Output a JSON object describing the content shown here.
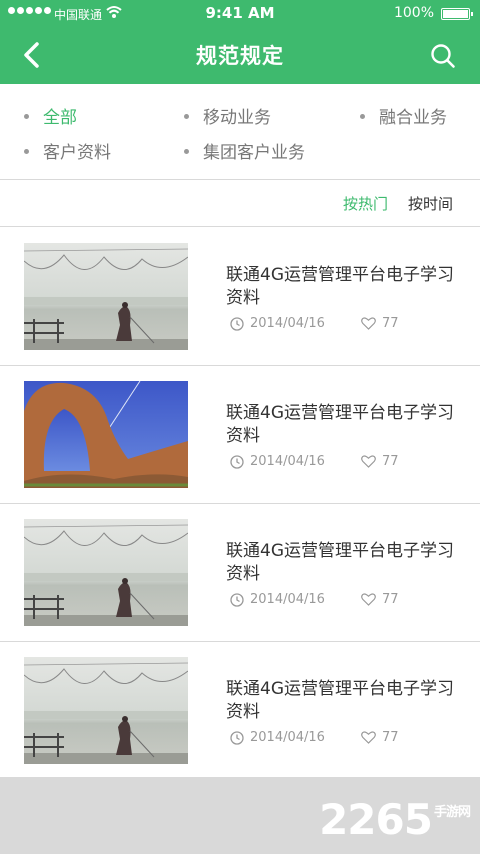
{
  "status": {
    "carrier": "中国联通",
    "time": "9:41 AM",
    "battery": "100%"
  },
  "header": {
    "title": "规范规定"
  },
  "categories": [
    "全部",
    "移动业务",
    "融合业务",
    "客户资料",
    "集团客户业务"
  ],
  "sort": {
    "hot": "按热门",
    "time": "按时间"
  },
  "articles": [
    {
      "title": "联通4G运营管理平台电子学习资料",
      "date": "2014/04/16",
      "likes": "77",
      "image": "man-with-rope-lake"
    },
    {
      "title": "联通4G运营管理平台电子学习资料",
      "date": "2014/04/16",
      "likes": "77",
      "image": "rock-arch"
    },
    {
      "title": "联通4G运营管理平台电子学习资料",
      "date": "2014/04/16",
      "likes": "77",
      "image": "man-with-rope-lake"
    },
    {
      "title": "联通4G运营管理平台电子学习资料",
      "date": "2014/04/16",
      "likes": "77",
      "image": "man-with-rope-lake"
    }
  ],
  "watermark": {
    "main": "2265",
    "sub": "手游网"
  },
  "colors": {
    "accent": "#3eba6e",
    "footer": "#d9d9d9"
  }
}
